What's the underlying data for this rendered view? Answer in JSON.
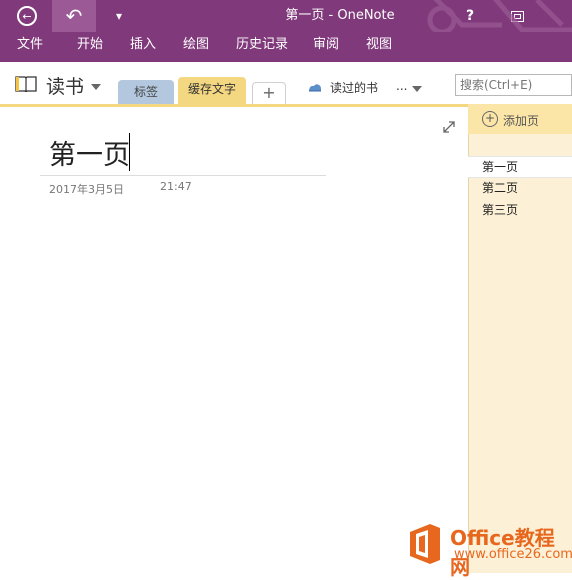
{
  "window": {
    "title": "第一页 - OneNote",
    "help_label": "?",
    "qat_label": "▾"
  },
  "menu": {
    "items": [
      "文件",
      "开始",
      "插入",
      "绘图",
      "历史记录",
      "审阅",
      "视图"
    ]
  },
  "notebook": {
    "name": "读书",
    "sections": [
      {
        "label": "标签",
        "active": false
      },
      {
        "label": "缓存文字",
        "active": true
      }
    ],
    "add_section_label": "+",
    "recent_label": "读过的书",
    "more_label": "..."
  },
  "search": {
    "placeholder": "搜索(Ctrl+E)"
  },
  "page": {
    "title": "第一页",
    "date": "2017年3月5日",
    "time": "21:47"
  },
  "pages_panel": {
    "add_label": "添加页",
    "items": [
      {
        "label": "第一页",
        "selected": true
      },
      {
        "label": "第二页",
        "selected": false
      },
      {
        "label": "第三页",
        "selected": false
      }
    ]
  },
  "watermark": {
    "brand": "Office教程网",
    "url": "www.office26.com"
  },
  "colors": {
    "accent": "#80397b",
    "section_active": "#f4d781",
    "section_tags": "#b3c8de",
    "page_panel": "#fcf1d6",
    "watermark": "#e8671e"
  }
}
